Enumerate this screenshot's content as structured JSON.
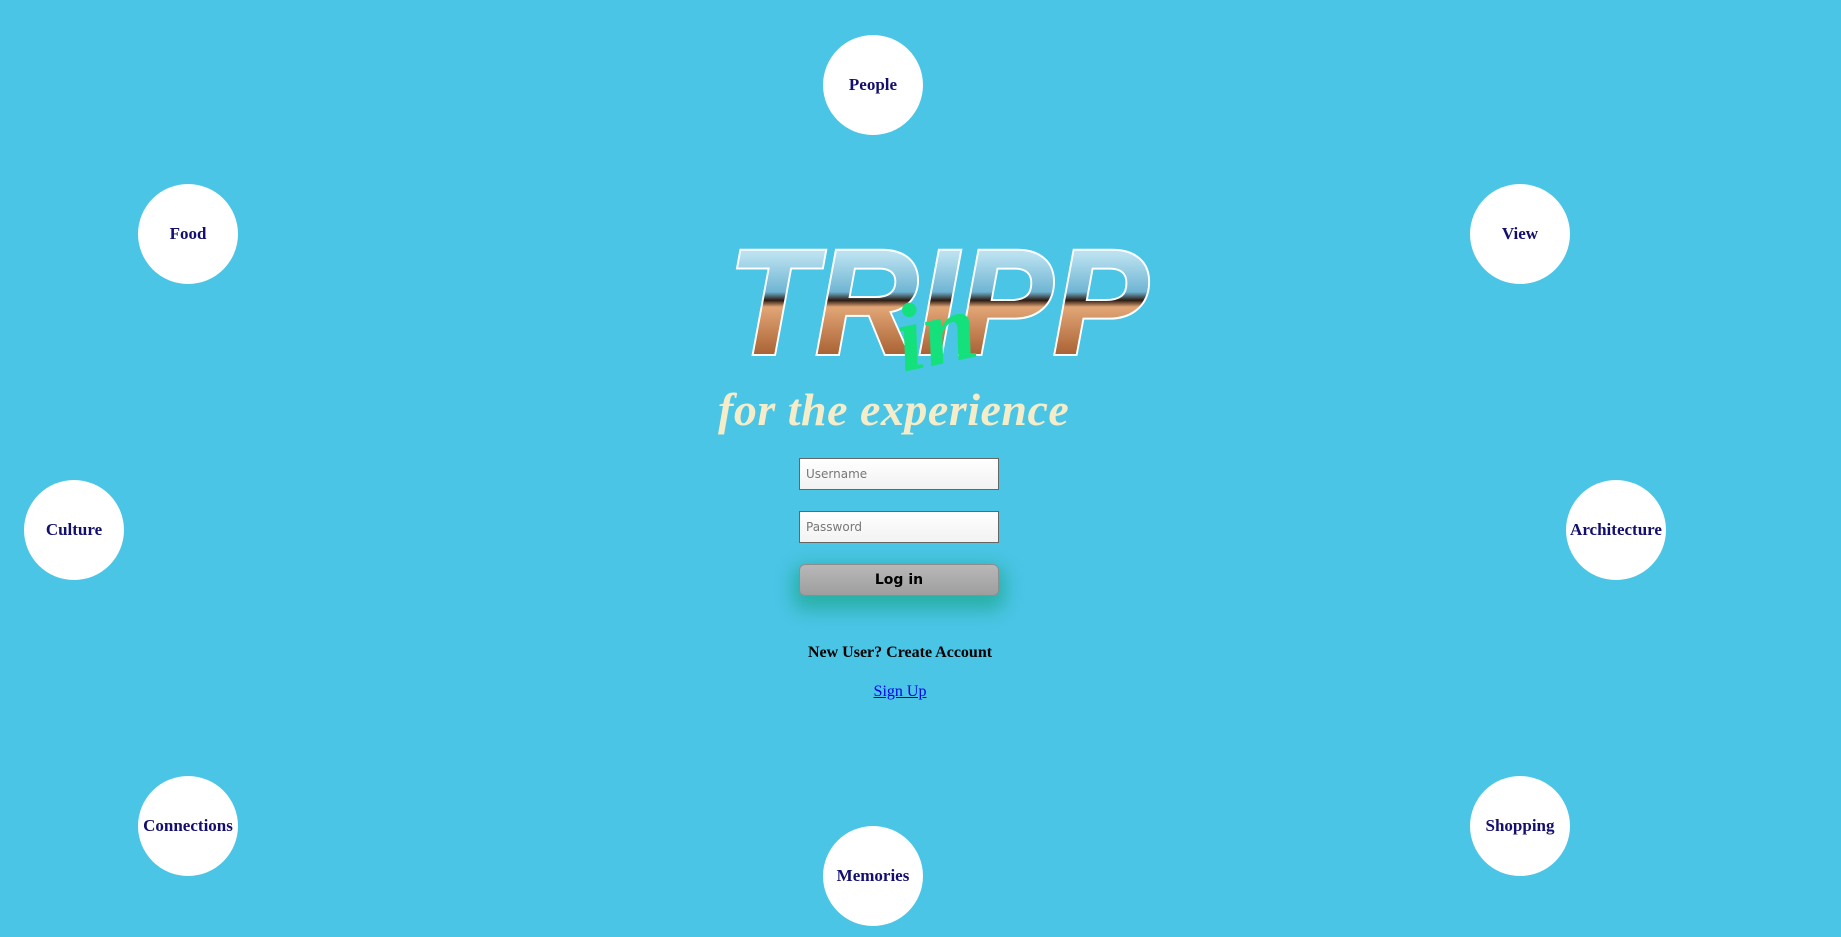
{
  "logo": {
    "word": "TRIPP",
    "script": "in"
  },
  "tagline": "for the experience",
  "bubbles": {
    "people": "People",
    "food": "Food",
    "view": "View",
    "culture": "Culture",
    "architecture": "Architecture",
    "connections": "Connections",
    "shopping": "Shopping",
    "memories": "Memories"
  },
  "form": {
    "username_placeholder": "Username",
    "username_value": "",
    "password_placeholder": "Password",
    "password_value": "",
    "login_label": "Log in"
  },
  "new_user_text": "New User? Create Account",
  "signup_link": "Sign Up",
  "colors": {
    "background": "#4ac5e6",
    "bubble": "#ffffff",
    "bubble_text": "#140f6e",
    "tagline": "#f5ecc9",
    "script_green": "#14e07c",
    "link": "#0000ee"
  }
}
